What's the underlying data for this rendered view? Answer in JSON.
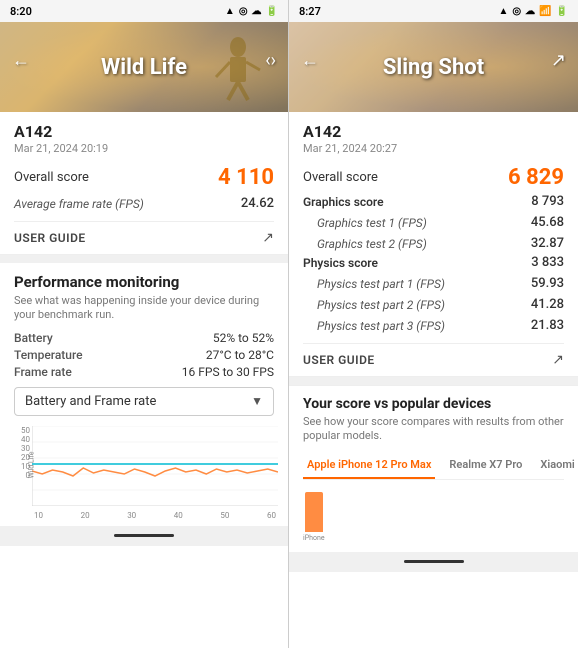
{
  "left": {
    "status": {
      "time": "8:20",
      "icons": [
        "▲",
        "◎",
        "☁"
      ]
    },
    "hero": {
      "title": "Wild Life"
    },
    "score_section": {
      "device_id": "A142",
      "date": "Mar 21, 2024 20:19",
      "overall_label": "Overall score",
      "overall_value": "4 110",
      "avg_frame_label": "Average frame rate (FPS)",
      "avg_frame_value": "24.62",
      "user_guide": "USER GUIDE"
    },
    "perf": {
      "title": "Performance monitoring",
      "desc": "See what was happening inside your device during your benchmark run.",
      "battery_label": "Battery",
      "battery_value": "52% to 52%",
      "temp_label": "Temperature",
      "temp_value": "27°C to 28°C",
      "frame_label": "Frame rate",
      "frame_value": "16 FPS to 30 FPS"
    },
    "dropdown": {
      "selected": "Battery and Frame rate"
    },
    "chart": {
      "y_labels": [
        "50",
        "40",
        "30",
        "20",
        "10",
        "0"
      ],
      "x_labels": [
        "10",
        "20",
        "30",
        "40",
        "50",
        "60"
      ],
      "y_axis_label": "Wild Life"
    }
  },
  "right": {
    "status": {
      "time": "8:27",
      "icons": [
        "▲",
        "◎",
        "☁"
      ]
    },
    "hero": {
      "title": "Sling Shot"
    },
    "score_section": {
      "device_id": "A142",
      "date": "Mar 21, 2024 20:27",
      "overall_label": "Overall score",
      "overall_value": "6 829",
      "graphics_label": "Graphics score",
      "graphics_value": "8 793",
      "graphics_test1_label": "Graphics test 1 (FPS)",
      "graphics_test1_value": "45.68",
      "graphics_test2_label": "Graphics test 2 (FPS)",
      "graphics_test2_value": "32.87",
      "physics_label": "Physics score",
      "physics_value": "3 833",
      "physics_test1_label": "Physics test part 1 (FPS)",
      "physics_test1_value": "59.93",
      "physics_test2_label": "Physics test part 2 (FPS)",
      "physics_test2_value": "41.28",
      "physics_test3_label": "Physics test part 3 (FPS)",
      "physics_test3_value": "21.83",
      "user_guide": "USER GUIDE"
    },
    "popular": {
      "title": "Your score vs popular devices",
      "desc": "See how your score compares with results from other popular models.",
      "tabs": [
        {
          "label": "Apple iPhone 12 Pro Max",
          "active": true
        },
        {
          "label": "Realme X7 Pro",
          "active": false
        },
        {
          "label": "Xiaomi M...",
          "active": false
        }
      ]
    }
  }
}
